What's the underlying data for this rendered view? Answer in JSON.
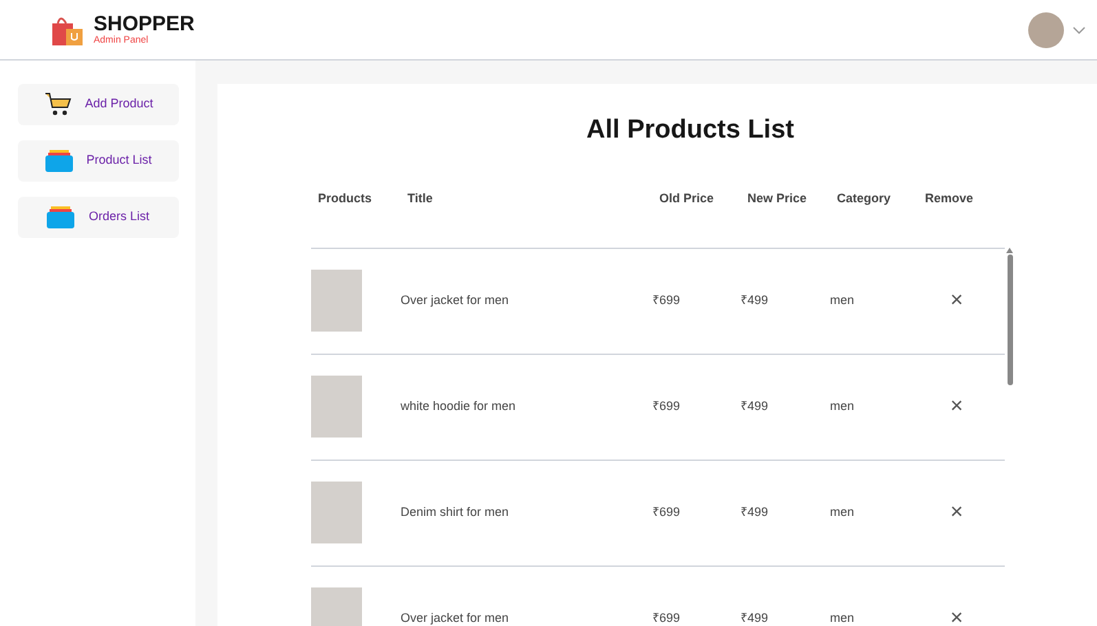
{
  "navbar": {
    "brand": "SHOPPER",
    "subtitle": "Admin Panel"
  },
  "sidebar": {
    "items": [
      {
        "label": "Add Product",
        "kind": "cart"
      },
      {
        "label": "Product List",
        "kind": "list"
      },
      {
        "label": "Orders List",
        "kind": "list"
      }
    ]
  },
  "title": "All Products List",
  "table": {
    "columns": [
      "Products",
      "Title",
      "Old Price",
      "New Price",
      "Category",
      "Remove"
    ],
    "rows": [
      {
        "title": "Over jacket for men",
        "old_price": "₹699",
        "new_price": "₹499",
        "category": "men",
        "remove": "×"
      },
      {
        "title": "white hoodie for men",
        "old_price": "₹699",
        "new_price": "₹499",
        "category": "men",
        "remove": "×"
      },
      {
        "title": "Denim shirt for men",
        "old_price": "₹699",
        "new_price": "₹499",
        "category": "men",
        "remove": "×"
      },
      {
        "title": "Over jacket for men",
        "old_price": "₹699",
        "new_price": "₹499",
        "category": "men",
        "remove": "×"
      }
    ]
  }
}
